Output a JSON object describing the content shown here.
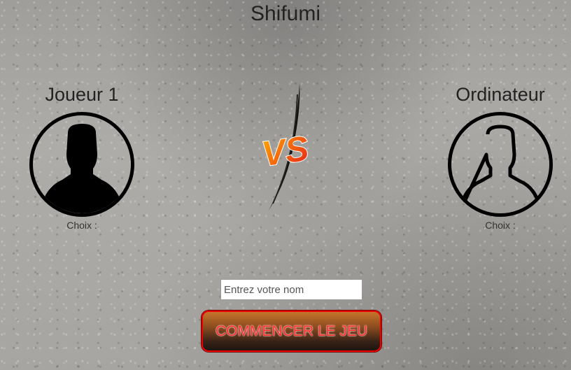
{
  "game": {
    "title": "Shifumi",
    "vs_text": "VS"
  },
  "player": {
    "name": "Joueur 1",
    "choice_label": "Choix :"
  },
  "computer": {
    "name": "Ordinateur",
    "choice_label": "Choix :"
  },
  "form": {
    "name_placeholder": "Entrez votre nom",
    "name_value": "",
    "start_button_label": "COMMENCER LE JEU"
  },
  "colors": {
    "button_border": "#e80000",
    "button_text": "#ff2a2a",
    "vs_gradient_start": "#ffb300",
    "vs_gradient_end": "#e81c1c"
  },
  "icons": {
    "player_avatar": "person-silhouette-filled-icon",
    "computer_avatar": "person-silhouette-outline-icon"
  }
}
